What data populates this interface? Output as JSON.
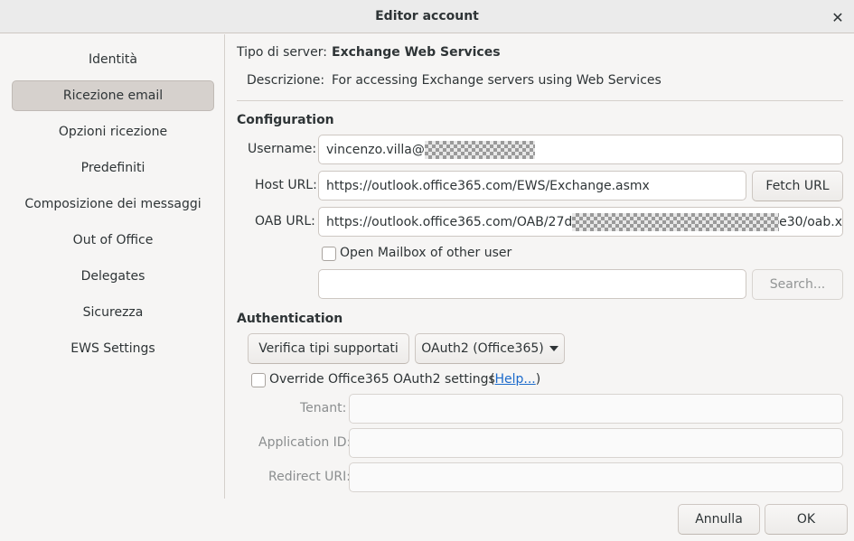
{
  "window": {
    "title": "Editor account"
  },
  "sidebar": {
    "items": [
      {
        "label": "Identità"
      },
      {
        "label": "Ricezione email"
      },
      {
        "label": "Opzioni ricezione"
      },
      {
        "label": "Predefiniti"
      },
      {
        "label": "Composizione dei messaggi"
      },
      {
        "label": "Out of Office"
      },
      {
        "label": "Delegates"
      },
      {
        "label": "Sicurezza"
      },
      {
        "label": "EWS Settings"
      }
    ],
    "active": "Ricezione email"
  },
  "server": {
    "type_label": "Tipo di server:",
    "type_value": "Exchange Web Services",
    "desc_label": "Descrizione:",
    "desc_value": "For accessing Exchange servers using Web Services"
  },
  "configuration": {
    "heading": "Configuration",
    "username_label": "Username:",
    "username_value": "vincenzo.villa@",
    "host_label": "Host URL:",
    "host_value": "https://outlook.office365.com/EWS/Exchange.asmx",
    "fetch_button": "Fetch URL",
    "oab_label": "OAB URL:",
    "oab_prefix": "https://outlook.office365.com/OAB/27d",
    "oab_suffix": "e30/oab.x",
    "open_mailbox_label": "Open Mailbox of other user",
    "open_mailbox_checked": false,
    "mailbox_value": "",
    "search_button": "Search..."
  },
  "authentication": {
    "heading": "Authentication",
    "verify_button": "Verifica tipi supportati",
    "method_value": "OAuth2 (Office365)",
    "override_label": "Override Office365 OAuth2 settings",
    "override_checked": false,
    "help_open": "(",
    "help_link": "Help...",
    "help_close": ")",
    "tenant_label": "Tenant:",
    "tenant_value": "",
    "appid_label": "Application ID:",
    "appid_value": "",
    "redirect_label": "Redirect URI:",
    "redirect_value": ""
  },
  "footer": {
    "cancel_button": "Annulla",
    "ok_button": "OK"
  },
  "icons": {
    "close": "close-icon",
    "dropdown": "chevron-down-icon",
    "redaction": "redacted-pattern"
  },
  "colors": {
    "accent_link": "#1b6acb",
    "sidebar_active": "#d6d1cd",
    "window_bg": "#f6f5f4"
  }
}
